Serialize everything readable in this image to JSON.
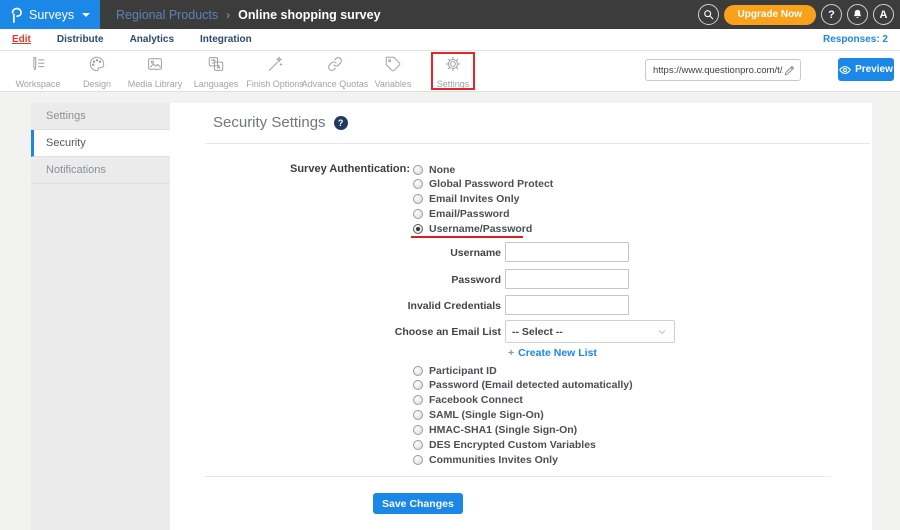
{
  "colors": {
    "brand_blue": "#1b87e6",
    "topbar_bg": "#3c3c3c",
    "upgrade_orange": "#f9a11b",
    "active_tab_red": "#e0382e",
    "annotation_red": "#e8242a",
    "nav_navy": "#2b4a73"
  },
  "topbar": {
    "logo_icon": "questionpro-logo",
    "product_menu": {
      "label": "Surveys",
      "icon": "caret-down-icon"
    },
    "breadcrumb": {
      "parent": "Regional Products",
      "separator": "›",
      "current": "Online shopping survey"
    },
    "search_icon": "search-icon",
    "upgrade_button": "Upgrade Now",
    "help_glyph": "?",
    "bell_icon": "bell-icon",
    "avatar": "A"
  },
  "nav": {
    "tabs": [
      {
        "label": "Edit",
        "active": true
      },
      {
        "label": "Distribute",
        "active": false
      },
      {
        "label": "Analytics",
        "active": false
      },
      {
        "label": "Integration",
        "active": false
      }
    ],
    "responses": "Responses: 2"
  },
  "toolbar": {
    "items": [
      {
        "label": "Workspace",
        "icon": "workspace-icon"
      },
      {
        "label": "Design",
        "icon": "design-palette-icon"
      },
      {
        "label": "Media Library",
        "icon": "media-library-icon"
      },
      {
        "label": "Languages",
        "icon": "languages-icon"
      },
      {
        "label": "Finish Options",
        "icon": "finish-options-wand-icon"
      },
      {
        "label": "Advance Quotas",
        "icon": "advance-quotas-chain-icon"
      },
      {
        "label": "Variables",
        "icon": "variables-tag-icon"
      },
      {
        "label": "Settings",
        "icon": "settings-gear-icon",
        "highlighted": true
      }
    ],
    "survey_url": "https://www.questionpro.com/t/APNrFZ",
    "edit_url_icon": "pencil-icon",
    "preview_button": {
      "label": "Preview",
      "icon": "eye-icon"
    }
  },
  "sidebar": {
    "items": [
      {
        "label": "Settings",
        "active": false
      },
      {
        "label": "Security",
        "active": true
      },
      {
        "label": "Notifications",
        "active": false
      }
    ]
  },
  "main": {
    "title": "Security Settings",
    "help_glyph": "?",
    "auth": {
      "label": "Survey Authentication:",
      "options": [
        {
          "label": "None",
          "selected": false
        },
        {
          "label": "Global Password Protect",
          "selected": false
        },
        {
          "label": "Email Invites Only",
          "selected": false
        },
        {
          "label": "Email/Password",
          "selected": false
        },
        {
          "label": "Username/Password",
          "selected": true,
          "annotated": true
        }
      ]
    },
    "fields": [
      {
        "label": "Username",
        "value": ""
      },
      {
        "label": "Password",
        "value": ""
      },
      {
        "label": "Invalid Credentials",
        "value": ""
      }
    ],
    "email_list": {
      "label": "Choose an Email List",
      "selected_option": "-- Select --",
      "icon": "chevron-down-icon"
    },
    "create_list": {
      "plus": "+",
      "label": "Create New List"
    },
    "more_options": [
      {
        "label": "Participant ID",
        "selected": false
      },
      {
        "label": "Password (Email detected automatically)",
        "selected": false
      },
      {
        "label": "Facebook Connect",
        "selected": false
      },
      {
        "label": "SAML (Single Sign-On)",
        "selected": false
      },
      {
        "label": "HMAC-SHA1 (Single Sign-On)",
        "selected": false
      },
      {
        "label": "DES Encrypted Custom Variables",
        "selected": false
      },
      {
        "label": "Communities Invites Only",
        "selected": false
      }
    ],
    "save_button": "Save Changes"
  }
}
